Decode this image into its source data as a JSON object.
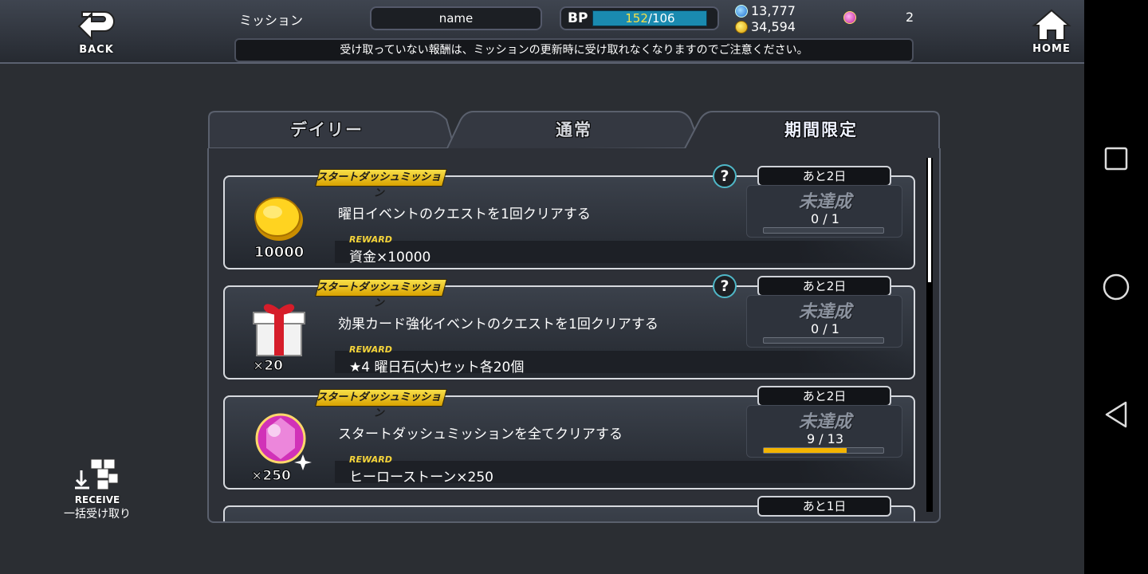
{
  "header": {
    "back_label": "BACK",
    "title": "ミッション",
    "player_name": "name",
    "bp_label": "BP",
    "bp_current": "152",
    "bp_max": "/106",
    "currency_blue": "13,777",
    "currency_gold": "34,594",
    "gem_count": "2",
    "home_label": "HOME",
    "notice": "受け取っていない報酬は、ミッションの更新時に受け取れなくなりますのでご注意ください。"
  },
  "tabs": [
    {
      "label": "デイリー",
      "active": false
    },
    {
      "label": "通常",
      "active": false
    },
    {
      "label": "期間限定",
      "active": true
    }
  ],
  "missions": [
    {
      "tag": "スタートダッシュミッション",
      "icon": "gold-coin-icon",
      "icon_count": "10000",
      "text": "曜日イベントのクエストを1回クリアする",
      "reward_label": "REWARD",
      "reward": "資金×10000",
      "help": "?",
      "time_left": "あと2日",
      "status": "未達成",
      "progress_text": "0 / 1",
      "progress": 0
    },
    {
      "tag": "スタートダッシュミッション",
      "icon": "gift-box-icon",
      "icon_count": "×20",
      "text": "効果カード強化イベントのクエストを1回クリアする",
      "reward_label": "REWARD",
      "reward": "★4 曜日石(大)セット各20個",
      "help": "?",
      "time_left": "あと2日",
      "status": "未達成",
      "progress_text": "0 / 1",
      "progress": 0
    },
    {
      "tag": "スタートダッシュミッション",
      "icon": "hero-stone-icon",
      "icon_count": "×250",
      "text": "スタートダッシュミッションを全てクリアする",
      "reward_label": "REWARD",
      "reward": "ヒーローストーン×250",
      "help": "",
      "time_left": "あと2日",
      "status": "未達成",
      "progress_text": "9 / 13",
      "progress": 0.69
    },
    {
      "time_left": "あと1日"
    }
  ],
  "receive": {
    "label": "RECEIVE",
    "sub": "一括受け取り"
  },
  "colors": {
    "accent_gold": "#f3b400",
    "bp_bar": "#1a8ab0",
    "help_ring": "#4fb7c7"
  }
}
